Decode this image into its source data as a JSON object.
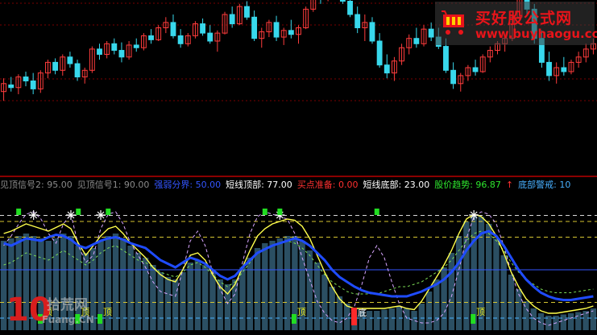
{
  "legend": {
    "items": [
      {
        "label": "见顶信号2: 95.00",
        "color": "#8a8a8a"
      },
      {
        "label": "见顶信号1: 90.00",
        "color": "#8a8a8a"
      },
      {
        "label": "强弱分界: 50.00",
        "color": "#3355ff"
      },
      {
        "label": "短线顶部: 77.00",
        "color": "#ffffff"
      },
      {
        "label": "买点准备: 0.00",
        "color": "#ff3030"
      },
      {
        "label": "短线底部: 23.00",
        "color": "#ffffff"
      },
      {
        "label": "股价趋势: 96.87",
        "color": "#2ee82e"
      },
      {
        "label": "↑",
        "color": "#ff3030"
      },
      {
        "label": "底部警戒: 10",
        "color": "#48b0ff"
      }
    ]
  },
  "watermark_top": {
    "title": "买好股公式网",
    "url": "www.buyhaogu.com"
  },
  "watermark_bottom": {
    "number": "10",
    "title": "拾荒网",
    "url": "Fuang.CN"
  },
  "signals": {
    "top": "顶",
    "bottom": "底"
  },
  "colors": {
    "background": "#000000",
    "candle_up": "#ff3c3c",
    "candle_down": "#38d8ec",
    "trend_line": "#1f4cff",
    "fast_line": "#ffff4c",
    "level_line": "#d6c531",
    "histogram": "#2b4f63",
    "dashed_a": "#d7a6ff",
    "dashed_b": "#7cdb55"
  },
  "chart_data": [
    {
      "type": "candlestick",
      "title": "",
      "ylim": [
        0,
        100
      ],
      "candles": [
        {
          "o": 22,
          "h": 32,
          "l": 15,
          "c": 28
        },
        {
          "o": 27,
          "h": 33,
          "l": 22,
          "c": 25
        },
        {
          "o": 25,
          "h": 35,
          "l": 20,
          "c": 33
        },
        {
          "o": 33,
          "h": 37,
          "l": 26,
          "c": 30
        },
        {
          "o": 30,
          "h": 36,
          "l": 20,
          "c": 24
        },
        {
          "o": 24,
          "h": 38,
          "l": 21,
          "c": 36
        },
        {
          "o": 36,
          "h": 46,
          "l": 32,
          "c": 44
        },
        {
          "o": 44,
          "h": 47,
          "l": 35,
          "c": 38
        },
        {
          "o": 38,
          "h": 50,
          "l": 34,
          "c": 48
        },
        {
          "o": 48,
          "h": 52,
          "l": 40,
          "c": 43
        },
        {
          "o": 43,
          "h": 46,
          "l": 30,
          "c": 33
        },
        {
          "o": 33,
          "h": 40,
          "l": 28,
          "c": 38
        },
        {
          "o": 38,
          "h": 56,
          "l": 36,
          "c": 54
        },
        {
          "o": 54,
          "h": 58,
          "l": 46,
          "c": 50
        },
        {
          "o": 50,
          "h": 60,
          "l": 47,
          "c": 58
        },
        {
          "o": 58,
          "h": 62,
          "l": 50,
          "c": 53
        },
        {
          "o": 53,
          "h": 59,
          "l": 44,
          "c": 48
        },
        {
          "o": 48,
          "h": 60,
          "l": 46,
          "c": 57
        },
        {
          "o": 57,
          "h": 62,
          "l": 52,
          "c": 55
        },
        {
          "o": 55,
          "h": 66,
          "l": 53,
          "c": 64
        },
        {
          "o": 64,
          "h": 69,
          "l": 58,
          "c": 61
        },
        {
          "o": 61,
          "h": 72,
          "l": 60,
          "c": 70
        },
        {
          "o": 70,
          "h": 78,
          "l": 66,
          "c": 74
        },
        {
          "o": 74,
          "h": 80,
          "l": 62,
          "c": 64
        },
        {
          "o": 64,
          "h": 69,
          "l": 55,
          "c": 58
        },
        {
          "o": 58,
          "h": 66,
          "l": 56,
          "c": 64
        },
        {
          "o": 64,
          "h": 75,
          "l": 62,
          "c": 73
        },
        {
          "o": 73,
          "h": 77,
          "l": 64,
          "c": 66
        },
        {
          "o": 66,
          "h": 72,
          "l": 58,
          "c": 60
        },
        {
          "o": 60,
          "h": 68,
          "l": 52,
          "c": 66
        },
        {
          "o": 66,
          "h": 82,
          "l": 65,
          "c": 80
        },
        {
          "o": 80,
          "h": 86,
          "l": 70,
          "c": 73
        },
        {
          "o": 73,
          "h": 88,
          "l": 72,
          "c": 86
        },
        {
          "o": 86,
          "h": 90,
          "l": 76,
          "c": 78
        },
        {
          "o": 78,
          "h": 83,
          "l": 60,
          "c": 62
        },
        {
          "o": 62,
          "h": 70,
          "l": 55,
          "c": 67
        },
        {
          "o": 67,
          "h": 76,
          "l": 63,
          "c": 74
        },
        {
          "o": 74,
          "h": 79,
          "l": 60,
          "c": 63
        },
        {
          "o": 63,
          "h": 70,
          "l": 57,
          "c": 68
        },
        {
          "o": 68,
          "h": 76,
          "l": 62,
          "c": 65
        },
        {
          "o": 65,
          "h": 72,
          "l": 58,
          "c": 70
        },
        {
          "o": 70,
          "h": 86,
          "l": 69,
          "c": 84
        },
        {
          "o": 84,
          "h": 98,
          "l": 82,
          "c": 96
        },
        {
          "o": 96,
          "h": 100,
          "l": 88,
          "c": 92
        },
        {
          "o": 92,
          "h": 100,
          "l": 90,
          "c": 99
        },
        {
          "o": 99,
          "h": 100,
          "l": 94,
          "c": 96
        },
        {
          "o": 96,
          "h": 100,
          "l": 88,
          "c": 90
        },
        {
          "o": 90,
          "h": 95,
          "l": 78,
          "c": 80
        },
        {
          "o": 80,
          "h": 86,
          "l": 66,
          "c": 70
        },
        {
          "o": 70,
          "h": 80,
          "l": 60,
          "c": 74
        },
        {
          "o": 74,
          "h": 78,
          "l": 58,
          "c": 60
        },
        {
          "o": 60,
          "h": 66,
          "l": 40,
          "c": 42
        },
        {
          "o": 42,
          "h": 50,
          "l": 32,
          "c": 36
        },
        {
          "o": 36,
          "h": 48,
          "l": 30,
          "c": 45
        },
        {
          "o": 45,
          "h": 58,
          "l": 42,
          "c": 55
        },
        {
          "o": 55,
          "h": 65,
          "l": 50,
          "c": 62
        },
        {
          "o": 62,
          "h": 70,
          "l": 55,
          "c": 58
        },
        {
          "o": 58,
          "h": 72,
          "l": 56,
          "c": 69
        },
        {
          "o": 69,
          "h": 74,
          "l": 60,
          "c": 63
        },
        {
          "o": 63,
          "h": 70,
          "l": 54,
          "c": 56
        },
        {
          "o": 56,
          "h": 62,
          "l": 36,
          "c": 38
        },
        {
          "o": 38,
          "h": 44,
          "l": 24,
          "c": 28
        },
        {
          "o": 28,
          "h": 36,
          "l": 22,
          "c": 34
        },
        {
          "o": 34,
          "h": 42,
          "l": 30,
          "c": 40
        },
        {
          "o": 40,
          "h": 46,
          "l": 34,
          "c": 37
        },
        {
          "o": 37,
          "h": 50,
          "l": 36,
          "c": 48
        },
        {
          "o": 48,
          "h": 56,
          "l": 44,
          "c": 53
        },
        {
          "o": 53,
          "h": 60,
          "l": 50,
          "c": 58
        },
        {
          "o": 58,
          "h": 64,
          "l": 52,
          "c": 62
        },
        {
          "o": 62,
          "h": 80,
          "l": 60,
          "c": 78
        },
        {
          "o": 78,
          "h": 96,
          "l": 76,
          "c": 94
        },
        {
          "o": 94,
          "h": 100,
          "l": 80,
          "c": 84
        },
        {
          "o": 84,
          "h": 88,
          "l": 58,
          "c": 62
        },
        {
          "o": 62,
          "h": 68,
          "l": 40,
          "c": 44
        },
        {
          "o": 44,
          "h": 52,
          "l": 30,
          "c": 34
        },
        {
          "o": 34,
          "h": 44,
          "l": 28,
          "c": 40
        },
        {
          "o": 40,
          "h": 48,
          "l": 34,
          "c": 37
        },
        {
          "o": 37,
          "h": 46,
          "l": 35,
          "c": 44
        },
        {
          "o": 44,
          "h": 52,
          "l": 40,
          "c": 48
        },
        {
          "o": 48,
          "h": 58,
          "l": 44,
          "c": 54
        },
        {
          "o": 54,
          "h": 62,
          "l": 50,
          "c": 58
        }
      ]
    },
    {
      "type": "line",
      "title": "",
      "ylim": [
        0,
        100
      ],
      "level_lines": [
        95,
        90,
        77,
        50,
        23,
        10
      ],
      "series": [
        {
          "key": "trend",
          "values": [
            72,
            70,
            73,
            76,
            75,
            74,
            77,
            79,
            78,
            75,
            70,
            68,
            71,
            74,
            76,
            77,
            75,
            72,
            70,
            68,
            63,
            58,
            55,
            52,
            56,
            60,
            58,
            55,
            50,
            45,
            42,
            45,
            52,
            58,
            64,
            67,
            70,
            72,
            74,
            76,
            74,
            70,
            64,
            58,
            50,
            44,
            40,
            36,
            33,
            31,
            30,
            29,
            28,
            28,
            28,
            30,
            32,
            35,
            38,
            42,
            48,
            56,
            66,
            74,
            80,
            82,
            78,
            70,
            60,
            50,
            42,
            36,
            31,
            28,
            26,
            25,
            25,
            26,
            27,
            28
          ]
        },
        {
          "key": "fast",
          "values": [
            80,
            82,
            85,
            88,
            86,
            84,
            82,
            85,
            88,
            84,
            72,
            62,
            70,
            78,
            84,
            86,
            80,
            72,
            66,
            60,
            52,
            46,
            42,
            40,
            50,
            62,
            64,
            58,
            46,
            36,
            30,
            38,
            52,
            66,
            78,
            84,
            88,
            90,
            92,
            91,
            86,
            76,
            62,
            48,
            36,
            26,
            20,
            18,
            18,
            18,
            18,
            18,
            19,
            20,
            18,
            17,
            24,
            34,
            44,
            54,
            66,
            80,
            92,
            96,
            94,
            88,
            78,
            64,
            48,
            36,
            26,
            20,
            16,
            14,
            14,
            15,
            16,
            17,
            18,
            20
          ]
        },
        {
          "key": "dashed_a",
          "values": [
            70,
            78,
            88,
            96,
            98,
            92,
            80,
            72,
            88,
            96,
            70,
            56,
            62,
            84,
            96,
            98,
            88,
            72,
            62,
            52,
            40,
            32,
            30,
            28,
            50,
            74,
            82,
            70,
            48,
            34,
            22,
            30,
            56,
            80,
            94,
            98,
            96,
            94,
            92,
            80,
            60,
            42,
            24,
            14,
            8,
            6,
            10,
            20,
            38,
            60,
            70,
            60,
            40,
            22,
            10,
            8,
            6,
            6,
            8,
            14,
            28,
            50,
            76,
            94,
            98,
            96,
            88,
            70,
            48,
            30,
            18,
            10,
            6,
            4,
            6,
            8,
            10,
            12,
            14,
            16
          ]
        },
        {
          "key": "dashed_b",
          "values": [
            54,
            56,
            60,
            64,
            62,
            60,
            58,
            62,
            66,
            62,
            58,
            54,
            58,
            64,
            68,
            70,
            66,
            62,
            58,
            56,
            52,
            48,
            46,
            44,
            48,
            54,
            56,
            52,
            46,
            40,
            36,
            40,
            48,
            56,
            64,
            68,
            70,
            72,
            74,
            72,
            68,
            62,
            54,
            46,
            40,
            36,
            32,
            30,
            30,
            30,
            30,
            32,
            34,
            36,
            36,
            38,
            40,
            44,
            48,
            52,
            58,
            66,
            74,
            80,
            82,
            80,
            74,
            66,
            56,
            48,
            42,
            38,
            34,
            32,
            31,
            31,
            31,
            32,
            33,
            34
          ]
        },
        {
          "key": "histogram",
          "values": [
            74,
            76,
            78,
            80,
            78,
            76,
            74,
            76,
            80,
            78,
            70,
            64,
            68,
            74,
            78,
            80,
            76,
            70,
            64,
            60,
            54,
            48,
            44,
            42,
            48,
            56,
            58,
            54,
            48,
            42,
            38,
            42,
            52,
            60,
            68,
            72,
            74,
            76,
            78,
            78,
            74,
            66,
            56,
            46,
            36,
            28,
            22,
            18,
            16,
            16,
            16,
            17,
            18,
            20,
            18,
            16,
            22,
            32,
            42,
            52,
            64,
            78,
            90,
            96,
            94,
            88,
            76,
            62,
            46,
            34,
            24,
            18,
            14,
            12,
            12,
            13,
            14,
            15,
            16,
            18
          ]
        }
      ],
      "markers": [
        {
          "type": "star",
          "x": 4
        },
        {
          "type": "star",
          "x": 9
        },
        {
          "type": "star",
          "x": 13
        },
        {
          "type": "star",
          "x": 37
        },
        {
          "type": "star",
          "x": 63
        },
        {
          "type": "green",
          "x": 2
        },
        {
          "type": "green",
          "x": 10
        },
        {
          "type": "green",
          "x": 14
        },
        {
          "type": "green",
          "x": 35
        },
        {
          "type": "green",
          "x": 37
        },
        {
          "type": "green",
          "x": 50
        },
        {
          "type": "top",
          "x": 5
        },
        {
          "type": "top",
          "x": 10
        },
        {
          "type": "top",
          "x": 13
        },
        {
          "type": "top",
          "x": 39
        },
        {
          "type": "top",
          "x": 63
        },
        {
          "type": "bottom",
          "x": 47
        }
      ]
    }
  ]
}
